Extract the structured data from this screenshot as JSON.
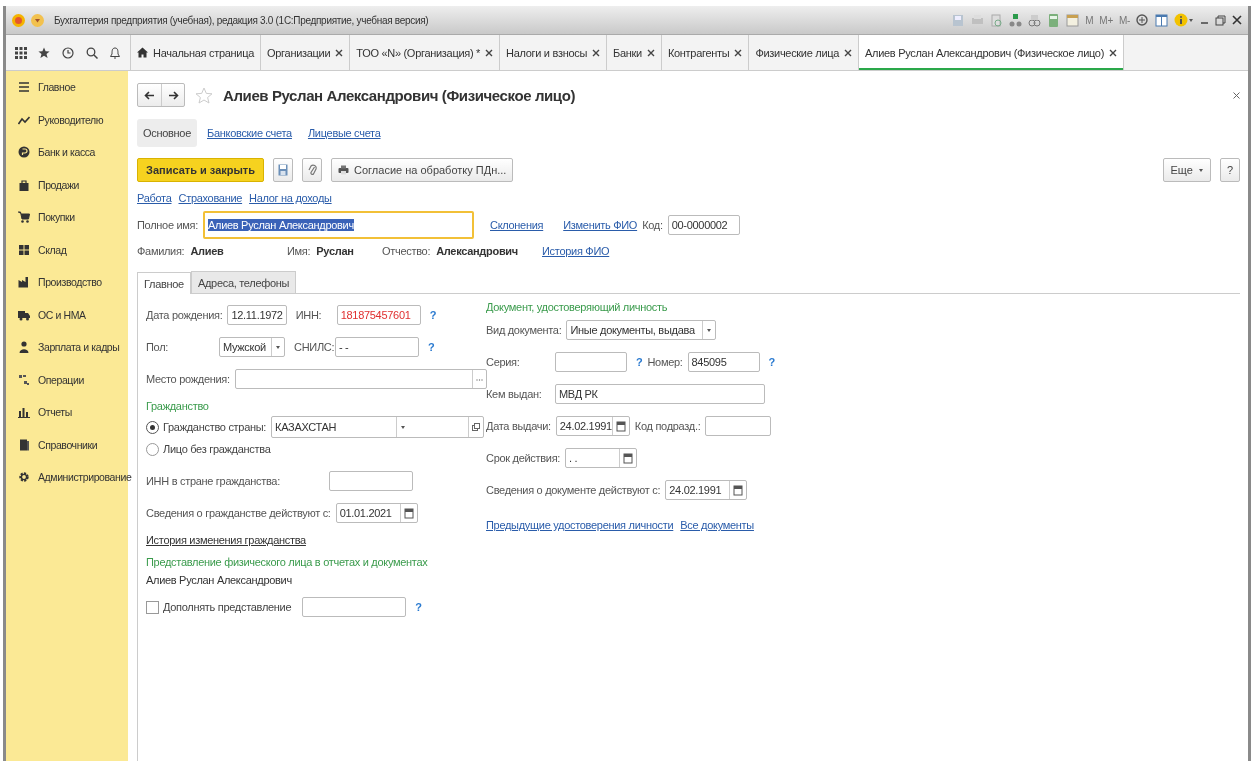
{
  "window": {
    "title": "Бухгалтерия предприятия (учебная), редакция 3.0 (1С:Предприятие, учебная версия)",
    "memory_buttons": [
      "M",
      "M+",
      "M-"
    ]
  },
  "nav_tabs": [
    {
      "label": "Начальная страница",
      "kind": "home",
      "selected": false
    },
    {
      "label": "Организации",
      "kind": "closable",
      "selected": false
    },
    {
      "label": "ТОО «N» (Организация) *",
      "kind": "closable",
      "selected": false
    },
    {
      "label": "Налоги и взносы",
      "kind": "closable",
      "selected": false
    },
    {
      "label": "Банки",
      "kind": "closable",
      "selected": false
    },
    {
      "label": "Контрагенты",
      "kind": "closable",
      "selected": false
    },
    {
      "label": "Физические лица",
      "kind": "closable",
      "selected": false
    },
    {
      "label": "Алиев Руслан Александрович (Физическое лицо)",
      "kind": "closable",
      "selected": true
    }
  ],
  "sidebar": {
    "items": [
      "Главное",
      "Руководителю",
      "Банк и касса",
      "Продажи",
      "Покупки",
      "Склад",
      "Производство",
      "ОС и НМА",
      "Зарплата и кадры",
      "Операции",
      "Отчеты",
      "Справочники",
      "Администрирование"
    ]
  },
  "form": {
    "title": "Алиев Руслан Александрович (Физическое лицо)",
    "favorite": false,
    "sections": [
      {
        "label": "Основное",
        "selected": true
      },
      {
        "label": "Банковские счета",
        "selected": false
      },
      {
        "label": "Лицевые счета",
        "selected": false
      }
    ],
    "save_close_button": "Записать и закрыть",
    "consent_button": "Согласие на обработку ПДн...",
    "more_button": "Еще",
    "help_button": "?",
    "links": [
      "Работа",
      "Страхование",
      "Налог на доходы"
    ],
    "full_name": {
      "label": "Полное имя:",
      "value": "Алиев Руслан Александрович",
      "highlighted": true
    },
    "declensions_link": "Склонения",
    "change_name_link": "Изменить ФИО",
    "name_history_link": "История ФИО",
    "code": {
      "label": "Код:",
      "value": "00-0000002"
    },
    "name_parts": [
      {
        "label": "Фамилия:",
        "value": "Алиев"
      },
      {
        "label": "Имя:",
        "value": "Руслан"
      },
      {
        "label": "Отчество:",
        "value": "Александрович"
      }
    ],
    "tabs": [
      {
        "label": "Главное",
        "selected": true
      },
      {
        "label": "Адреса, телефоны",
        "selected": false
      }
    ],
    "personal": {
      "birth_date": {
        "label": "Дата рождения:",
        "value": "12.11.1972"
      },
      "inn": {
        "label": "ИНН:",
        "value": "181875457601",
        "invalid": true,
        "help": "?"
      },
      "gender": {
        "label": "Пол:",
        "value": "Мужской"
      },
      "snils": {
        "label": "СНИЛС:",
        "value": "-  -",
        "help": "?"
      },
      "birth_place": {
        "label": "Место рождения:"
      }
    },
    "citizenship": {
      "heading": "Гражданство",
      "options": [
        {
          "label": "Гражданство страны:",
          "selected": true
        },
        {
          "label": "Лицо без гражданства",
          "selected": false
        }
      ],
      "country": "КАЗАХСТАН",
      "foreign_inn": {
        "label": "ИНН в стране гражданства:"
      },
      "valid_from": {
        "label": "Сведения о гражданстве действуют с:",
        "value": "01.01.2021"
      },
      "history_link": "История изменения гражданства"
    },
    "representation": {
      "heading": "Представление физического лица в отчетах и документах",
      "text": "Алиев Руслан Александрович",
      "extend": {
        "label": "Дополнять представление",
        "checked": false
      },
      "help": "?"
    },
    "document": {
      "heading": "Документ, удостоверяющий личность",
      "type": {
        "label": "Вид документа:",
        "value": "Иные документы, выдава"
      },
      "series": {
        "label": "Серия:",
        "help": "?"
      },
      "number": {
        "label": "Номер:",
        "value": "845095",
        "help": "?"
      },
      "issued_by": {
        "label": "Кем выдан:",
        "value": "МВД РК"
      },
      "issue_date": {
        "label": "Дата выдачи:",
        "value": "24.02.1991"
      },
      "dept_code": {
        "label": "Код подразд.:"
      },
      "valid_until": {
        "label": "Срок действия:",
        "value": ". ."
      },
      "valid_from": {
        "label": "Сведения о документе действуют с:",
        "value": "24.02.1991"
      },
      "links": [
        "Предыдущие удостоверения личности",
        "Все документы"
      ]
    }
  }
}
